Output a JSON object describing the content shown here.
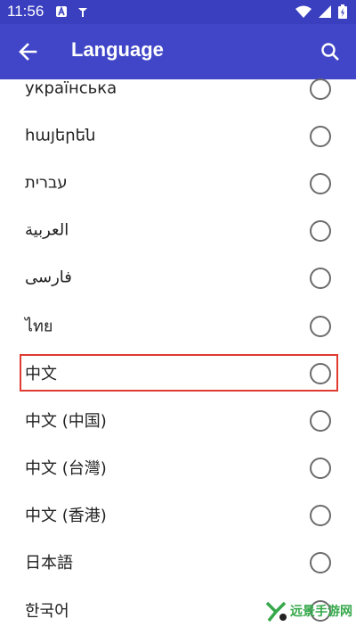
{
  "status_bar": {
    "time": "11:56"
  },
  "app_bar": {
    "title": "Language"
  },
  "languages": [
    {
      "label": "українська"
    },
    {
      "label": "հայերեն"
    },
    {
      "label": "עברית"
    },
    {
      "label": "العربية"
    },
    {
      "label": "فارسی"
    },
    {
      "label": "ไทย"
    },
    {
      "label": "中文"
    },
    {
      "label": "中文 (中国)"
    },
    {
      "label": "中文 (台灣)"
    },
    {
      "label": "中文 (香港)"
    },
    {
      "label": "日本語"
    },
    {
      "label": "한국어"
    }
  ],
  "icons": {
    "back": "arrow-back-icon",
    "search": "search-icon"
  },
  "colors": {
    "app_bar": "#4046c7",
    "status_bar": "#3a3fc0",
    "highlight": "#e03a31"
  },
  "watermark": {
    "text": "远景手游网"
  }
}
